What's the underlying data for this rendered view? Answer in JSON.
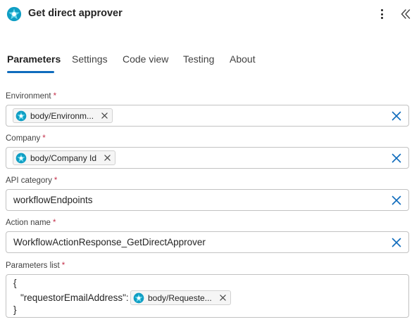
{
  "header": {
    "title": "Get direct approver",
    "brand_color": "#0f9ec4"
  },
  "tabs": [
    {
      "label": "Parameters",
      "active": true
    },
    {
      "label": "Settings",
      "active": false
    },
    {
      "label": "Code view",
      "active": false
    },
    {
      "label": "Testing",
      "active": false
    },
    {
      "label": "About",
      "active": false
    }
  ],
  "fields": {
    "environment": {
      "label": "Environment",
      "required_mark": "*",
      "token": "body/Environm..."
    },
    "company": {
      "label": "Company",
      "required_mark": "*",
      "token": "body/Company Id"
    },
    "api_category": {
      "label": "API category",
      "required_mark": "*",
      "value": "workflowEndpoints"
    },
    "action_name": {
      "label": "Action name",
      "required_mark": "*",
      "value": "WorkflowActionResponse_GetDirectApprover"
    },
    "parameters_list": {
      "label": "Parameters list",
      "required_mark": "*",
      "open_brace": "{",
      "key": "\"requestorEmailAddress\":",
      "token": "body/Requeste...",
      "close_brace": "}"
    }
  },
  "colors": {
    "accent": "#0f6cbd",
    "required": "#c4314b"
  },
  "icons": {
    "app": "dataverse-icon",
    "more": "more-vertical-icon",
    "collapse": "double-chevron-left-icon",
    "clear": "close-icon"
  }
}
